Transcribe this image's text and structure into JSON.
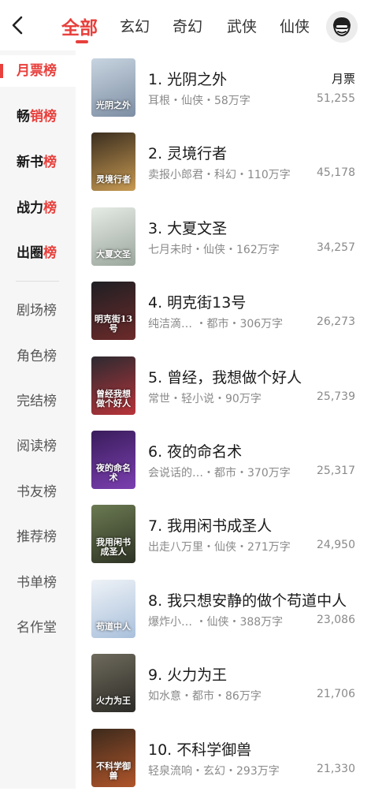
{
  "header": {
    "tabs": [
      {
        "label": "全部",
        "active": true
      },
      {
        "label": "玄幻"
      },
      {
        "label": "奇幻"
      },
      {
        "label": "武侠"
      },
      {
        "label": "仙侠"
      }
    ],
    "accent_color": "#e8403c"
  },
  "sidebar": {
    "items": [
      {
        "label": "月票榜",
        "active": true
      },
      {
        "prefix": "畅",
        "highlight": "销榜"
      },
      {
        "prefix": "新书",
        "highlight": "榜"
      },
      {
        "prefix": "战力",
        "highlight": "榜"
      },
      {
        "prefix": "出圈",
        "highlight": "榜"
      },
      {
        "label": "剧场榜"
      },
      {
        "label": "角色榜"
      },
      {
        "label": "完结榜"
      },
      {
        "label": "阅读榜"
      },
      {
        "label": "书友榜"
      },
      {
        "label": "推荐榜"
      },
      {
        "label": "书单榜"
      },
      {
        "label": "名作堂"
      }
    ]
  },
  "list": {
    "metric_label": "月票",
    "books": [
      {
        "title": "1. 光阴之外",
        "meta": "耳根・仙侠・58万字",
        "tickets": "51,255",
        "cover_text": "光阴之外",
        "cover_colors": [
          "#c8d4e0",
          "#7d8ea3"
        ]
      },
      {
        "title": "2. 灵境行者",
        "meta": "卖报小郎君・科幻・110万字",
        "tickets": "45,178",
        "cover_text": "灵境行者",
        "cover_colors": [
          "#3b2e1f",
          "#c89a52"
        ]
      },
      {
        "title": "3. 大夏文圣",
        "meta": "七月未时・仙侠・162万字",
        "tickets": "34,257",
        "cover_text": "大夏文圣",
        "cover_colors": [
          "#e6ebe6",
          "#9aa69c"
        ]
      },
      {
        "title": "4. 明克街13号",
        "meta": "纯洁滴…  ・都市・306万字",
        "tickets": "26,273",
        "cover_text": "明克街13号",
        "cover_colors": [
          "#1e1f23",
          "#6d2a2a"
        ]
      },
      {
        "title": "5. 曾经，我想做个好人",
        "meta": "常世・轻小说・90万字",
        "tickets": "25,739",
        "cover_text": "曾经我想做个好人",
        "cover_colors": [
          "#2b2a30",
          "#b8343a"
        ]
      },
      {
        "title": "6. 夜的命名术",
        "meta": "会说话的…・都市・370万字",
        "tickets": "25,317",
        "cover_text": "夜的命名术",
        "cover_colors": [
          "#3a1d5c",
          "#7b3fb0"
        ]
      },
      {
        "title": "7. 我用闲书成圣人",
        "meta": "出走八万里・仙侠・271万字",
        "tickets": "24,950",
        "cover_text": "我用闲书成圣人",
        "cover_colors": [
          "#6b7a52",
          "#2e3324"
        ]
      },
      {
        "title": "8. 我只想安静的做个苟道中人",
        "meta": "爆炸小…  ・仙侠・388万字",
        "tickets": "23,086",
        "cover_text": "苟道中人",
        "cover_colors": [
          "#eef2f7",
          "#a9c0db"
        ]
      },
      {
        "title": "9. 火力为王",
        "meta": "如水意・都市・86万字",
        "tickets": "21,706",
        "cover_text": "火力为王",
        "cover_colors": [
          "#6e6a5c",
          "#2c2b26"
        ]
      },
      {
        "title": "10. 不科学御兽",
        "meta": "轻泉流响・玄幻・293万字",
        "tickets": "21,330",
        "cover_text": "不科学御兽",
        "cover_colors": [
          "#3c2a1c",
          "#b0552a"
        ]
      }
    ]
  },
  "icons": {
    "back": "chevron-left-icon",
    "avatar": "user-avatar-icon"
  }
}
